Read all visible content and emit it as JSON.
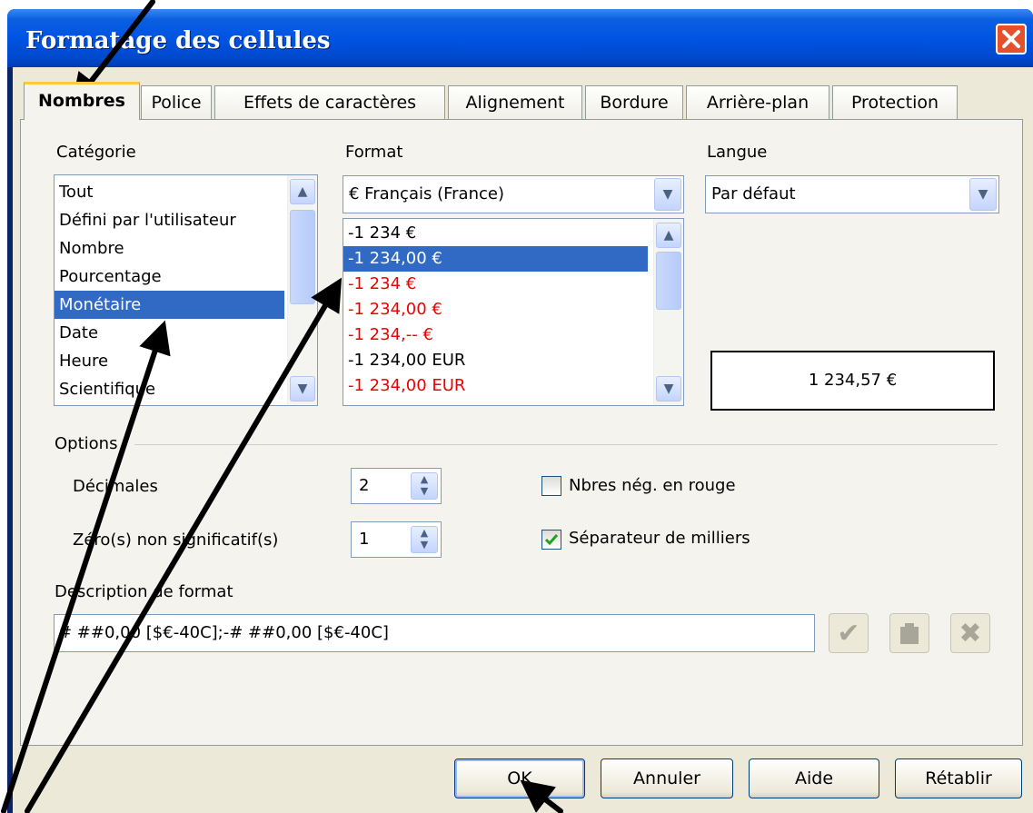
{
  "window": {
    "title": "Formatage des cellules"
  },
  "tabs": [
    "Nombres",
    "Police",
    "Effets de caractères",
    "Alignement",
    "Bordure",
    "Arrière-plan",
    "Protection"
  ],
  "categorie": {
    "label": "Catégorie",
    "items": [
      "Tout",
      "Défini par l'utilisateur",
      "Nombre",
      "Pourcentage",
      "Monétaire",
      "Date",
      "Heure",
      "Scientifique"
    ],
    "selected": "Monétaire"
  },
  "format": {
    "label": "Format",
    "combo_value": "€ Français (France)",
    "items": [
      {
        "text": "-1 234 €",
        "red": false
      },
      {
        "text": "-1 234,00 €",
        "red": false,
        "selected": true
      },
      {
        "text": "-1 234 €",
        "red": true
      },
      {
        "text": "-1 234,00 €",
        "red": true
      },
      {
        "text": "-1 234,-- €",
        "red": true
      },
      {
        "text": "-1 234,00 EUR",
        "red": false
      },
      {
        "text": "-1 234,00 EUR",
        "red": true
      }
    ]
  },
  "langue": {
    "label": "Langue",
    "value": "Par défaut"
  },
  "preview": "1 234,57 €",
  "options": {
    "label": "Options",
    "decimales_label": "Décimales",
    "decimales_value": "2",
    "zeros_label": "Zéro(s) non significatif(s)",
    "zeros_value": "1",
    "neg_red_label": "Nbres nég. en rouge",
    "neg_red_checked": false,
    "thousands_label": "Séparateur de milliers",
    "thousands_checked": true
  },
  "description": {
    "label": "Description de format",
    "value": "# ##0,00 [$€-40C];-# ##0,00 [$€-40C]"
  },
  "buttons": {
    "ok": "OK",
    "cancel": "Annuler",
    "help": "Aide",
    "reset": "Rétablir"
  }
}
